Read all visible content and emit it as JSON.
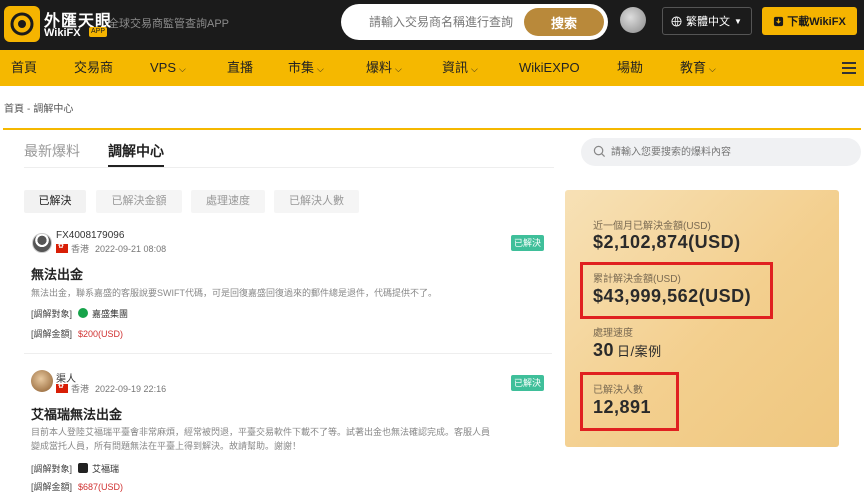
{
  "header": {
    "brand_cn": "外匯天眼",
    "brand_en": "WikiFX",
    "brand_badge": "APP",
    "slogan": "全球交易商監管查詢APP",
    "search_placeholder": "請輸入交易商名稱進行查詢",
    "search_button": "搜索",
    "language": "繁體中文",
    "download": "下載WikiFX"
  },
  "nav": {
    "items": [
      {
        "label": "首頁"
      },
      {
        "label": "交易商"
      },
      {
        "label": "VPS",
        "dropdown": true
      },
      {
        "label": "直播"
      },
      {
        "label": "市集",
        "dropdown": true
      },
      {
        "label": "爆料",
        "dropdown": true
      },
      {
        "label": "資訊",
        "dropdown": true
      },
      {
        "label": "WikiEXPO"
      },
      {
        "label": "場勘"
      },
      {
        "label": "教育",
        "dropdown": true
      }
    ]
  },
  "breadcrumb": {
    "home": "首頁",
    "separator": "-",
    "current": "調解中心"
  },
  "tabs": [
    {
      "label": "最新爆料",
      "active": false
    },
    {
      "label": "調解中心",
      "active": true
    }
  ],
  "complaint_search": {
    "placeholder": "請輸入您要搜索的爆料內容"
  },
  "filters": [
    {
      "label": "已解決",
      "active": true
    },
    {
      "label": "已解決金額",
      "active": false
    },
    {
      "label": "處理速度",
      "active": false
    },
    {
      "label": "已解決人數",
      "active": false
    }
  ],
  "entries": [
    {
      "user": "FX4008179096",
      "region": "香港",
      "date": "2022-09-21 08:08",
      "status": "已解決",
      "title": "無法出金",
      "description": "無法出金，聯系嘉盛的客服說要SWIFT代碼，可是回復嘉盛回復過來的郵件總是退件，代碼提供不了。",
      "target_label": "[調解對象]",
      "target_name": "嘉盛集團",
      "amount_label": "[調解金額]",
      "amount": "$200(USD)",
      "logo_color": "#16a34a"
    },
    {
      "user": "渠人",
      "region": "香港",
      "date": "2022-09-19 22:16",
      "status": "已解決",
      "title": "艾福瑞無法出金",
      "description_lines": [
        "目前本人登陸艾福瑞平臺會非常麻煩，經常被閃退，平臺交易軟件下載不了等。試著出金也無法確認完成。客服人員",
        "變成當托人員，所有問題無法在平臺上得到解決。故請幫助。謝謝！"
      ],
      "target_label": "[調解對象]",
      "target_name": "艾福瑞",
      "amount_label": "[調解金額]",
      "amount": "$687(USD)",
      "logo_color": "#222222"
    }
  ],
  "stats": {
    "last_month_label": "近一個月已解決金額(USD)",
    "last_month_value": "$2,102,874(USD)",
    "total_label": "累計解決金額(USD)",
    "total_value": "$43,999,562(USD)",
    "speed_label": "處理速度",
    "speed_value": "30",
    "speed_unit": "日/案例",
    "people_label": "已解決人數",
    "people_value": "12,891"
  },
  "colors": {
    "header_bg": "#1b1b1b",
    "accent": "#f5b800",
    "search_button": "#b9893a",
    "resolved_badge": "#3fbf9a",
    "amount_red": "#d03030",
    "highlight": "#e02020"
  }
}
